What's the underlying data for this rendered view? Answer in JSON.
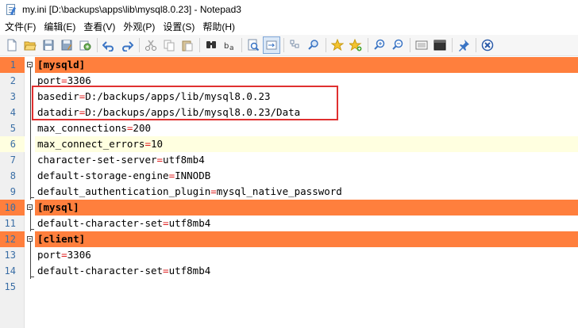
{
  "window": {
    "title": "my.ini [D:\\backups\\apps\\lib\\mysql8.0.23] - Notepad3"
  },
  "menu": {
    "items": [
      {
        "label": "文件(F)"
      },
      {
        "label": "编辑(E)"
      },
      {
        "label": "查看(V)"
      },
      {
        "label": "外观(P)"
      },
      {
        "label": "设置(S)"
      },
      {
        "label": "帮助(H)"
      }
    ]
  },
  "toolbar": {
    "buttons": [
      "new-icon",
      "open-icon",
      "save-icon",
      "save-as-icon",
      "browse-icon",
      "undo-icon",
      "redo-icon",
      "cut-icon",
      "copy-icon",
      "paste-icon",
      "find-icon",
      "replace-icon",
      "goto-icon",
      "word-wrap-icon",
      "zoom-in-icon",
      "zoom-out-icon",
      "favorites-icon",
      "add-favorite-icon",
      "zoom-in-2-icon",
      "zoom-out-2-icon",
      "settings-icon",
      "run-icon",
      "pin-icon",
      "close-icon"
    ]
  },
  "editor": {
    "lines": [
      {
        "num": "1",
        "type": "section",
        "text": "[mysqld]"
      },
      {
        "num": "2",
        "type": "kv",
        "key": "port",
        "value": "3306"
      },
      {
        "num": "3",
        "type": "kv",
        "key": "basedir",
        "value": "D:/backups/apps/lib/mysql8.0.23"
      },
      {
        "num": "4",
        "type": "kv",
        "key": "datadir",
        "value": "D:/backups/apps/lib/mysql8.0.23/Data"
      },
      {
        "num": "5",
        "type": "kv",
        "key": "max_connections",
        "value": "200"
      },
      {
        "num": "6",
        "type": "kv",
        "key": "max_connect_errors",
        "value": "10",
        "current": true
      },
      {
        "num": "7",
        "type": "kv",
        "key": "character-set-server",
        "value": "utf8mb4"
      },
      {
        "num": "8",
        "type": "kv",
        "key": "default-storage-engine",
        "value": "INNODB"
      },
      {
        "num": "9",
        "type": "kv",
        "key": "default_authentication_plugin",
        "value": "mysql_native_password"
      },
      {
        "num": "10",
        "type": "section",
        "text": "[mysql]"
      },
      {
        "num": "11",
        "type": "kv",
        "key": "default-character-set",
        "value": "utf8mb4"
      },
      {
        "num": "12",
        "type": "section",
        "text": "[client]"
      },
      {
        "num": "13",
        "type": "kv",
        "key": "port",
        "value": "3306"
      },
      {
        "num": "14",
        "type": "kv",
        "key": "default-character-set",
        "value": "utf8mb4"
      },
      {
        "num": "15",
        "type": "empty"
      }
    ],
    "equals_sign": "="
  },
  "colors": {
    "section_bg": "#ff7f3d",
    "current_line_bg": "#ffffe0",
    "equals": "#e02020",
    "line_number": "#3a6ea5",
    "annotation": "#e03030"
  }
}
